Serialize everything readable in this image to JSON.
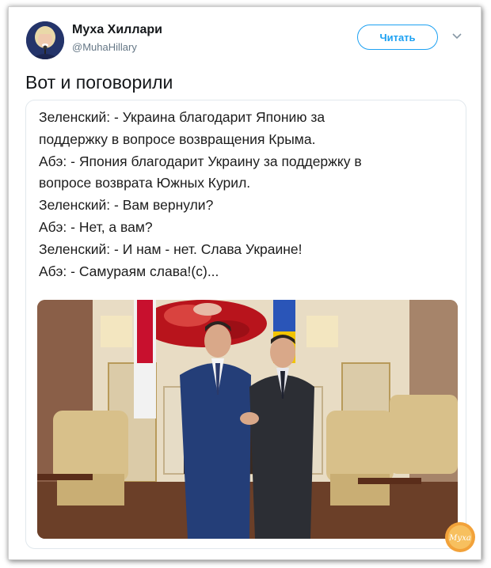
{
  "tweet": {
    "author_name": "Муха Хиллари",
    "author_handle": "@MuhaHillary",
    "follow_label": "Читать",
    "text": "Вот и поговорили"
  },
  "card": {
    "lines": [
      "Зеленский: - Украина благодарит Японию за",
      "поддержку в вопросе возвращения Крыма.",
      "Абэ: - Япония благодарит Украину за поддержку в",
      "вопросе возврата Южных Курил.",
      "Зеленский: - Вам вернули?",
      "Абэ: - Нет, а вам?",
      "Зеленский: - И нам - нет. Слава Украине!",
      "Абэ: - Самураям слава!(с)..."
    ]
  },
  "watermark": {
    "text": "Муха"
  },
  "colors": {
    "accent": "#1da1f2",
    "ukraine_blue": "#2a55b8",
    "ukraine_yellow": "#f2c400",
    "japan_red": "#c8102e"
  },
  "icons": {
    "menu": "chevron-down-icon"
  }
}
